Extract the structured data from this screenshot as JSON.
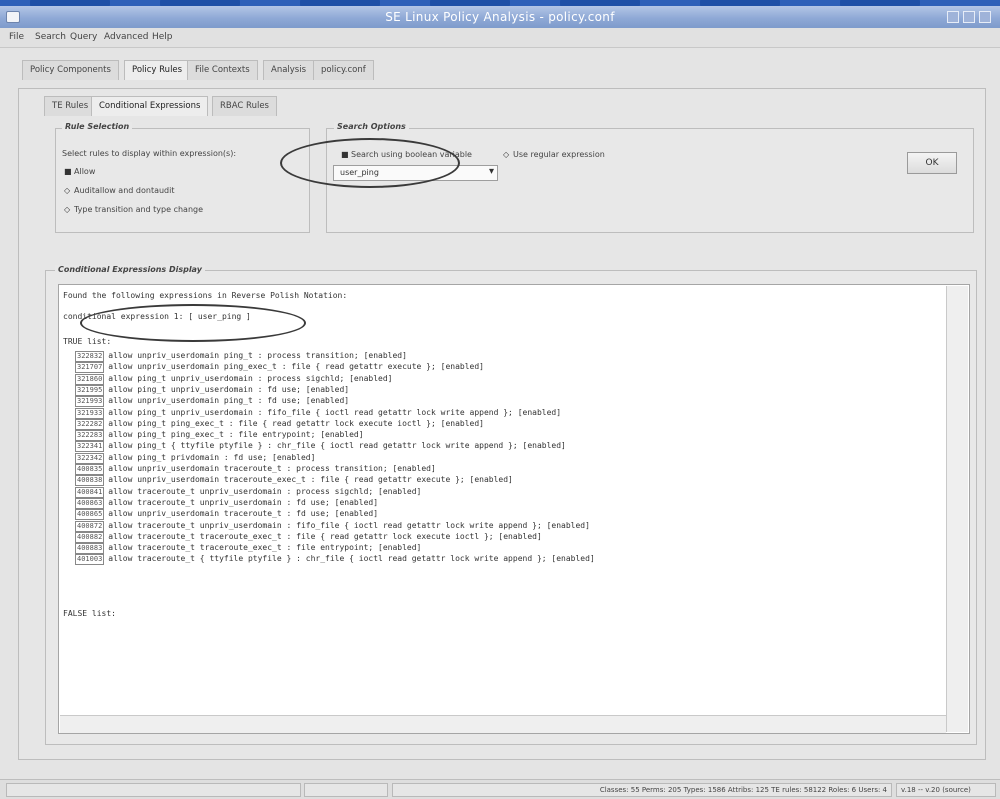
{
  "window": {
    "title": "SE Linux Policy Analysis - policy.conf"
  },
  "menu": [
    "File",
    "Search",
    "Query",
    "Advanced",
    "Help"
  ],
  "main_tabs": [
    "Policy Components",
    "Policy Rules",
    "File Contexts",
    "Analysis",
    "policy.conf"
  ],
  "sub_tabs": [
    "TE Rules",
    "Conditional Expressions",
    "RBAC Rules"
  ],
  "rule_selection": {
    "title": "Rule Selection",
    "prompt": "Select rules to display within expression(s):",
    "options": [
      "Allow",
      "Auditallow and dontaudit",
      "Type transition and type change"
    ],
    "selected": 0
  },
  "search_options": {
    "title": "Search Options",
    "bool_checkbox_label": "Search using boolean variable",
    "regex_label": "Use regular expression",
    "boolean_value": "user_ping"
  },
  "ok_button_label": "OK",
  "display": {
    "title": "Conditional Expressions Display",
    "header_line": "Found the following expressions in Reverse Polish Notation:",
    "expression_line": "conditional expression 1: [ user_ping ]",
    "true_label": "TRUE list:",
    "false_label": "FALSE list:",
    "true_rules": [
      {
        "id": "322832",
        "text": "allow unpriv_userdomain ping_t : process transition; [enabled]"
      },
      {
        "id": "321707",
        "text": "allow unpriv_userdomain ping_exec_t : file { read getattr execute }; [enabled]"
      },
      {
        "id": "321860",
        "text": "allow ping_t unpriv_userdomain : process sigchld; [enabled]"
      },
      {
        "id": "321995",
        "text": "allow ping_t unpriv_userdomain : fd use; [enabled]"
      },
      {
        "id": "321993",
        "text": "allow unpriv_userdomain ping_t : fd use; [enabled]"
      },
      {
        "id": "321933",
        "text": "allow ping_t unpriv_userdomain : fifo_file { ioctl read getattr lock write append }; [enabled]"
      },
      {
        "id": "322282",
        "text": "allow ping_t ping_exec_t : file { read getattr lock execute ioctl }; [enabled]"
      },
      {
        "id": "322283",
        "text": "allow ping_t ping_exec_t : file entrypoint; [enabled]"
      },
      {
        "id": "322341",
        "text": "allow ping_t { ttyfile ptyfile } : chr_file { ioctl read getattr lock write append }; [enabled]"
      },
      {
        "id": "322342",
        "text": "allow ping_t privdomain : fd use; [enabled]"
      },
      {
        "id": "400835",
        "text": "allow unpriv_userdomain traceroute_t : process transition; [enabled]"
      },
      {
        "id": "400838",
        "text": "allow unpriv_userdomain traceroute_exec_t : file { read getattr execute }; [enabled]"
      },
      {
        "id": "400841",
        "text": "allow traceroute_t unpriv_userdomain : process sigchld; [enabled]"
      },
      {
        "id": "400863",
        "text": "allow traceroute_t unpriv_userdomain : fd use; [enabled]"
      },
      {
        "id": "400865",
        "text": "allow unpriv_userdomain traceroute_t : fd use; [enabled]"
      },
      {
        "id": "400872",
        "text": "allow traceroute_t unpriv_userdomain : fifo_file { ioctl read getattr lock write append }; [enabled]"
      },
      {
        "id": "400882",
        "text": "allow traceroute_t traceroute_exec_t : file { read getattr lock execute ioctl }; [enabled]"
      },
      {
        "id": "400883",
        "text": "allow traceroute_t traceroute_exec_t : file entrypoint; [enabled]"
      },
      {
        "id": "401003",
        "text": "allow traceroute_t { ttyfile ptyfile } : chr_file { ioctl read getattr lock write append }; [enabled]"
      }
    ]
  },
  "status": {
    "stats": "Classes: 55  Perms: 205  Types: 1586  Attribs: 125  TE rules: 58122  Roles: 6  Users: 4",
    "version": "v.18 -- v.20 (source)"
  }
}
